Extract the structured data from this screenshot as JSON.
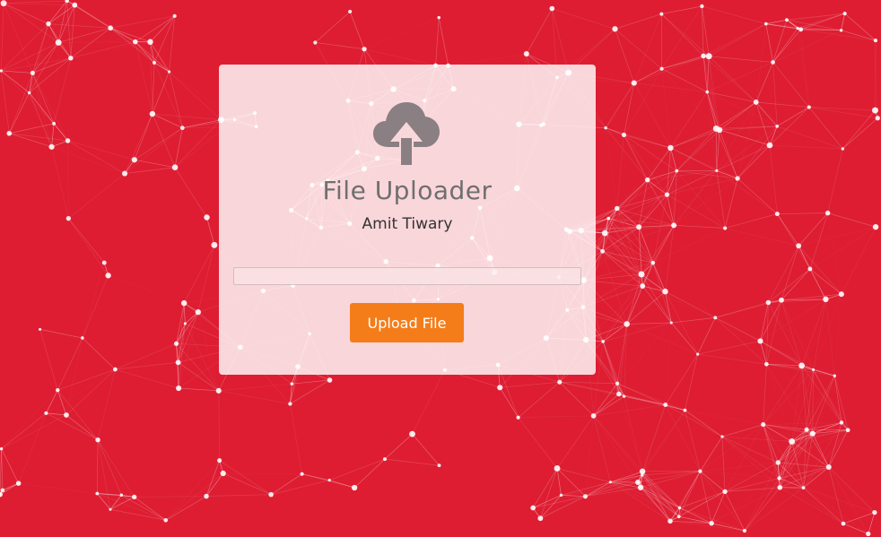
{
  "colors": {
    "background": "#de1d32",
    "network": "#ffffff",
    "card": "#ffffffd1",
    "icon": "#8a7f82",
    "title": "#6f6f6f",
    "subtitle": "#333333",
    "button": "#f47d1a",
    "button_text": "#ffffff"
  },
  "uploader": {
    "icon": "cloud-upload-icon",
    "title": "File Uploader",
    "author": "Amit Tiwary",
    "file_input": {
      "value": ""
    },
    "upload_button_label": "Upload File"
  }
}
